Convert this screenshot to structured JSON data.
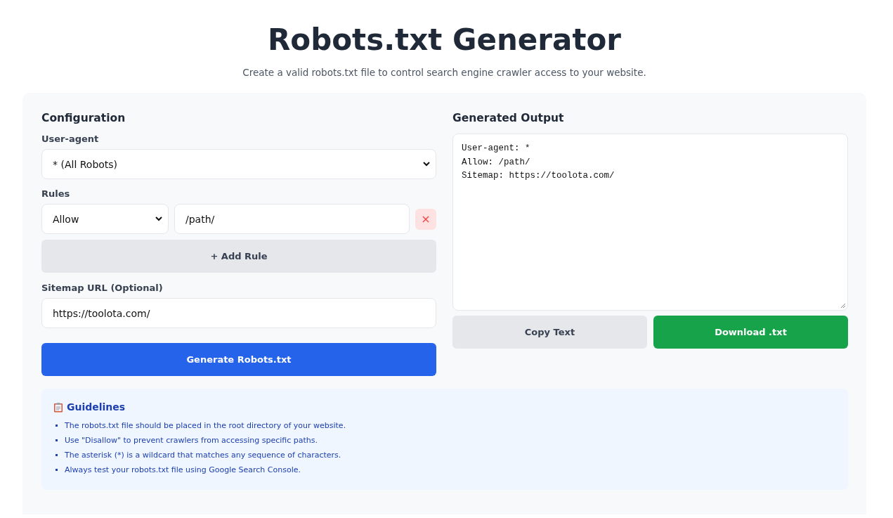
{
  "header": {
    "title": "Robots.txt Generator",
    "subtitle": "Create a valid robots.txt file to control search engine crawler access to your website."
  },
  "configuration": {
    "heading": "Configuration",
    "user_agent": {
      "label": "User-agent",
      "value": "* (All Robots)"
    },
    "rules": {
      "label": "Rules",
      "items": [
        {
          "directive": "Allow",
          "path": "/path/",
          "remove": "×"
        }
      ],
      "add_button": "+ Add Rule"
    },
    "sitemap": {
      "label": "Sitemap URL (Optional)",
      "value": "https://toolota.com/"
    },
    "generate_button": "Generate Robots.txt"
  },
  "output": {
    "heading": "Generated Output",
    "lines": [
      "User-agent: *",
      "Allow: /path/",
      "Sitemap: https://toolota.com/"
    ],
    "buttons": [
      {
        "label": "Copy Text",
        "kind": "secondary"
      },
      {
        "label": "Download .txt",
        "kind": "primary"
      }
    ]
  },
  "guidelines": {
    "title": "Guidelines",
    "items": [
      "The robots.txt file should be placed in the root directory of your website.",
      "Use \"Disallow\" to prevent crawlers from accessing specific paths.",
      "The asterisk (*) is a wildcard that matches any sequence of characters.",
      "Always test your robots.txt file using Google Search Console."
    ]
  }
}
